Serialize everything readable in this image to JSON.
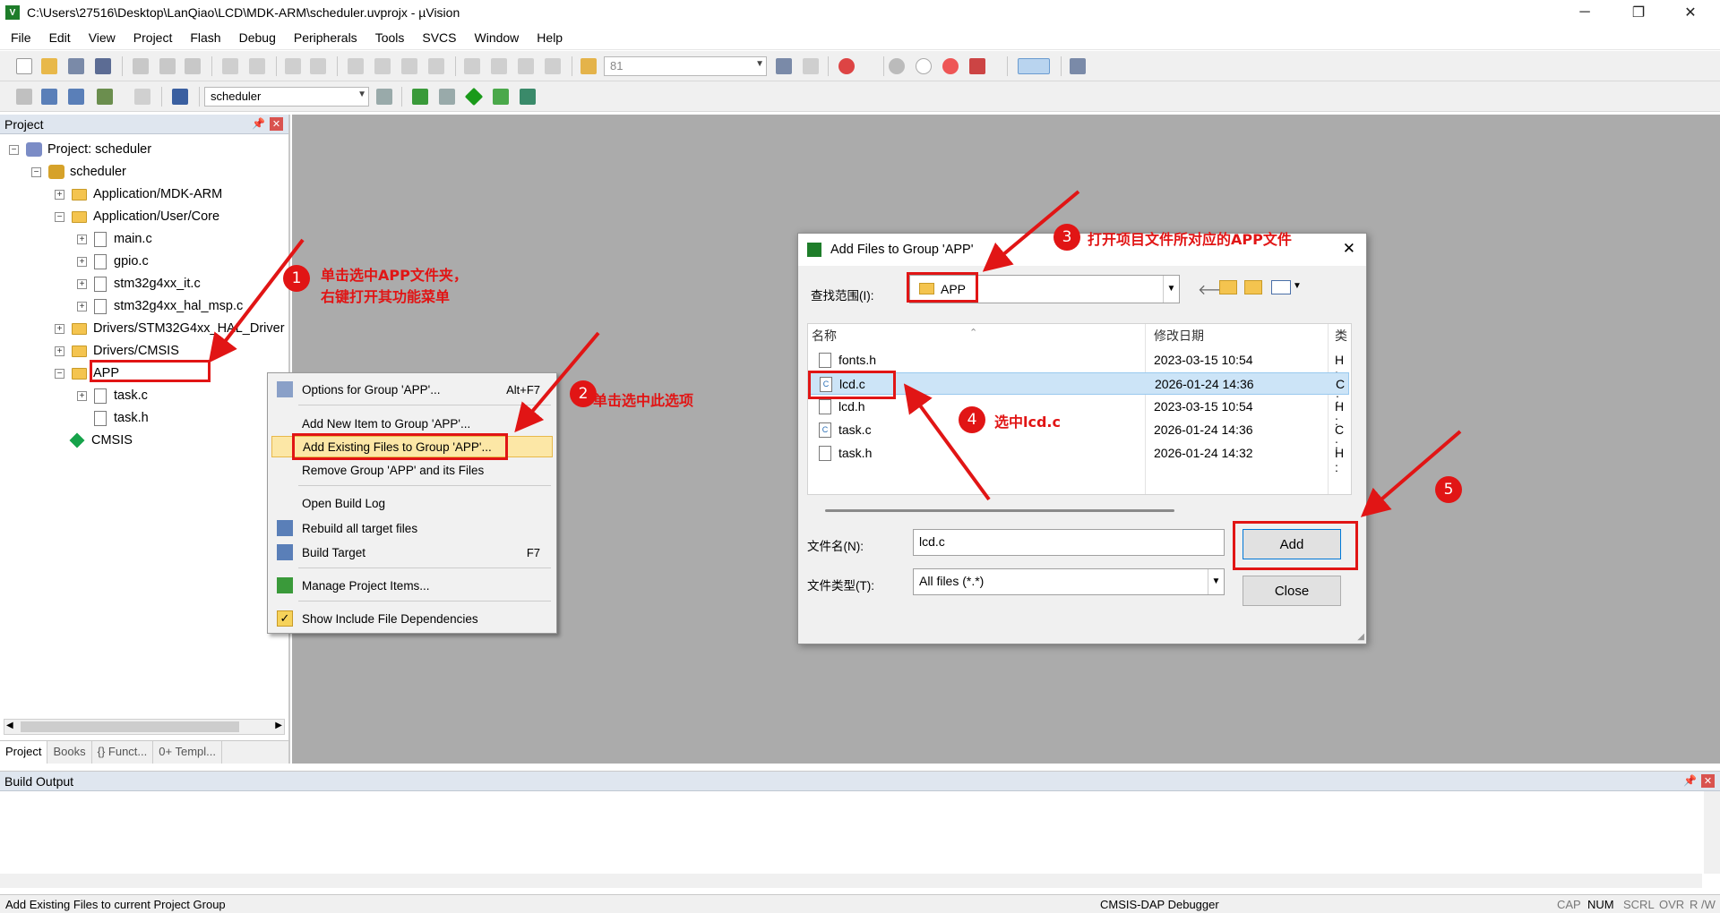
{
  "window": {
    "title": "C:\\Users\\27516\\Desktop\\LanQiao\\LCD\\MDK-ARM\\scheduler.uvprojx - µVision"
  },
  "menu": [
    "File",
    "Edit",
    "View",
    "Project",
    "Flash",
    "Debug",
    "Peripherals",
    "Tools",
    "SVCS",
    "Window",
    "Help"
  ],
  "toolbar": {
    "find_value": "81",
    "target_value": "scheduler"
  },
  "project_panel": {
    "title": "Project",
    "tree": [
      {
        "label": "Project: scheduler"
      },
      {
        "label": "scheduler"
      },
      {
        "label": "Application/MDK-ARM"
      },
      {
        "label": "Application/User/Core"
      },
      {
        "label": "main.c"
      },
      {
        "label": "gpio.c"
      },
      {
        "label": "stm32g4xx_it.c"
      },
      {
        "label": "stm32g4xx_hal_msp.c"
      },
      {
        "label": "Drivers/STM32G4xx_HAL_Driver"
      },
      {
        "label": "Drivers/CMSIS"
      },
      {
        "label": "APP"
      },
      {
        "label": "task.c"
      },
      {
        "label": "task.h"
      },
      {
        "label": "CMSIS"
      }
    ],
    "tabs": [
      "Project",
      "Books",
      "{} Funct...",
      "0+ Templ..."
    ]
  },
  "context_menu": {
    "items": [
      {
        "label": "Options for Group 'APP'...",
        "shortcut": "Alt+F7"
      },
      {
        "label": "Add New  Item to Group 'APP'...",
        "shortcut": ""
      },
      {
        "label": "Add Existing Files to Group 'APP'...",
        "shortcut": ""
      },
      {
        "label": "Remove Group 'APP' and its Files",
        "shortcut": ""
      },
      {
        "label": "Open Build Log",
        "shortcut": ""
      },
      {
        "label": "Rebuild all target files",
        "shortcut": ""
      },
      {
        "label": "Build Target",
        "shortcut": "F7"
      },
      {
        "label": "Manage Project Items...",
        "shortcut": ""
      },
      {
        "label": "Show Include File Dependencies",
        "shortcut": ""
      }
    ]
  },
  "dialog": {
    "title": "Add Files to Group 'APP'",
    "lookin_label": "查找范围(I):",
    "lookin_value": "APP",
    "columns": [
      "名称",
      "修改日期",
      "类"
    ],
    "files": [
      {
        "name": "fonts.h",
        "date": "2023-03-15 10:54",
        "type": "H :"
      },
      {
        "name": "lcd.c",
        "date": "2026-01-24 14:36",
        "type": "C :"
      },
      {
        "name": "lcd.h",
        "date": "2023-03-15 10:54",
        "type": "H :"
      },
      {
        "name": "task.c",
        "date": "2026-01-24 14:36",
        "type": "C :"
      },
      {
        "name": "task.h",
        "date": "2026-01-24 14:32",
        "type": "H :"
      }
    ],
    "filename_label": "文件名(N):",
    "filename_value": "lcd.c",
    "filetype_label": "文件类型(T):",
    "filetype_value": "All files (*.*)",
    "add_label": "Add",
    "close_label": "Close"
  },
  "build_output": {
    "title": "Build Output"
  },
  "status": {
    "message": "Add Existing Files to current Project Group",
    "debugger": "CMSIS-DAP Debugger",
    "indicators": [
      "CAP",
      "NUM",
      "SCRL",
      "OVR",
      "R /W"
    ]
  },
  "annotations": {
    "n1": "1",
    "t1a": "单击选中APP文件夹，",
    "t1b": "右键打开其功能菜单",
    "n2": "2",
    "t2": "单击选中此选项",
    "n3": "3",
    "t3": "打开项目文件所对应的APP文件",
    "n4": "4",
    "t4": "选中lcd.c",
    "n5": "5"
  },
  "colors": {
    "annotation_red": "#e11515",
    "panel_header": "#dfe6ef",
    "workspace_gray": "#ababab",
    "selection": "#cce4f7"
  }
}
